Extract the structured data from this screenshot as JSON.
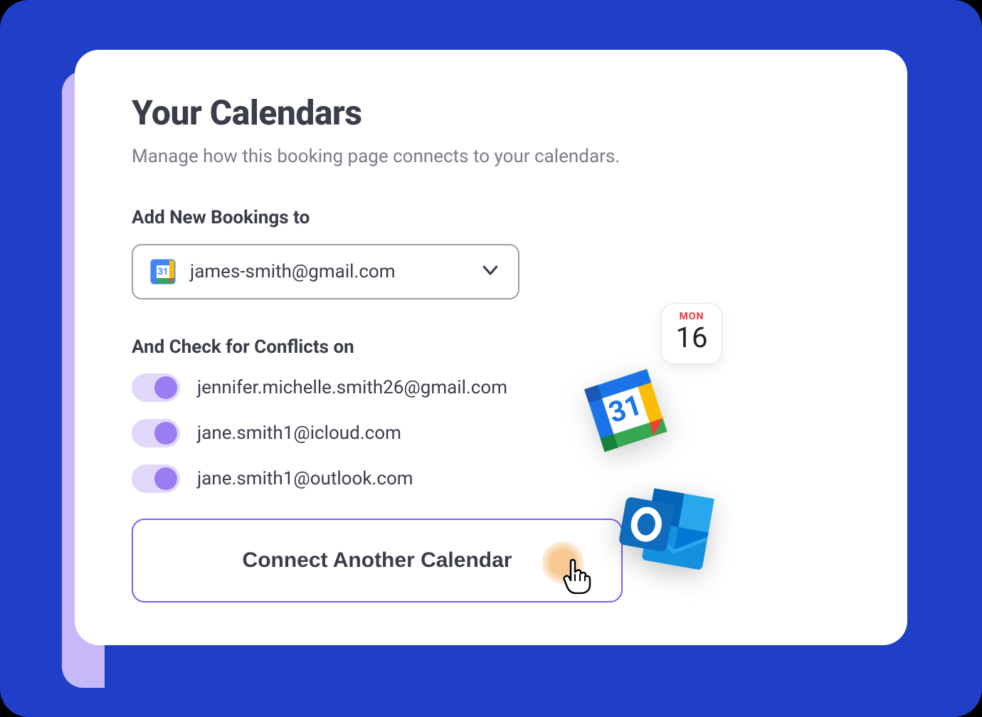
{
  "header": {
    "title": "Your Calendars",
    "subtitle": "Manage how this booking page connects to your calendars."
  },
  "add_bookings": {
    "label": "Add New Bookings to",
    "selected": "james-smith@gmail.com"
  },
  "conflicts": {
    "label": "And Check for Conflicts on",
    "items": [
      {
        "email": "jennifer.michelle.smith26@gmail.com",
        "enabled": true
      },
      {
        "email": "jane.smith1@icloud.com",
        "enabled": true
      },
      {
        "email": "jane.smith1@outlook.com",
        "enabled": true
      }
    ]
  },
  "connect_button": "Connect Another Calendar",
  "apple_calendar_tile": {
    "day_label": "MON",
    "day_number": "16"
  },
  "google_calendar_tile": {
    "day_number": "31"
  }
}
